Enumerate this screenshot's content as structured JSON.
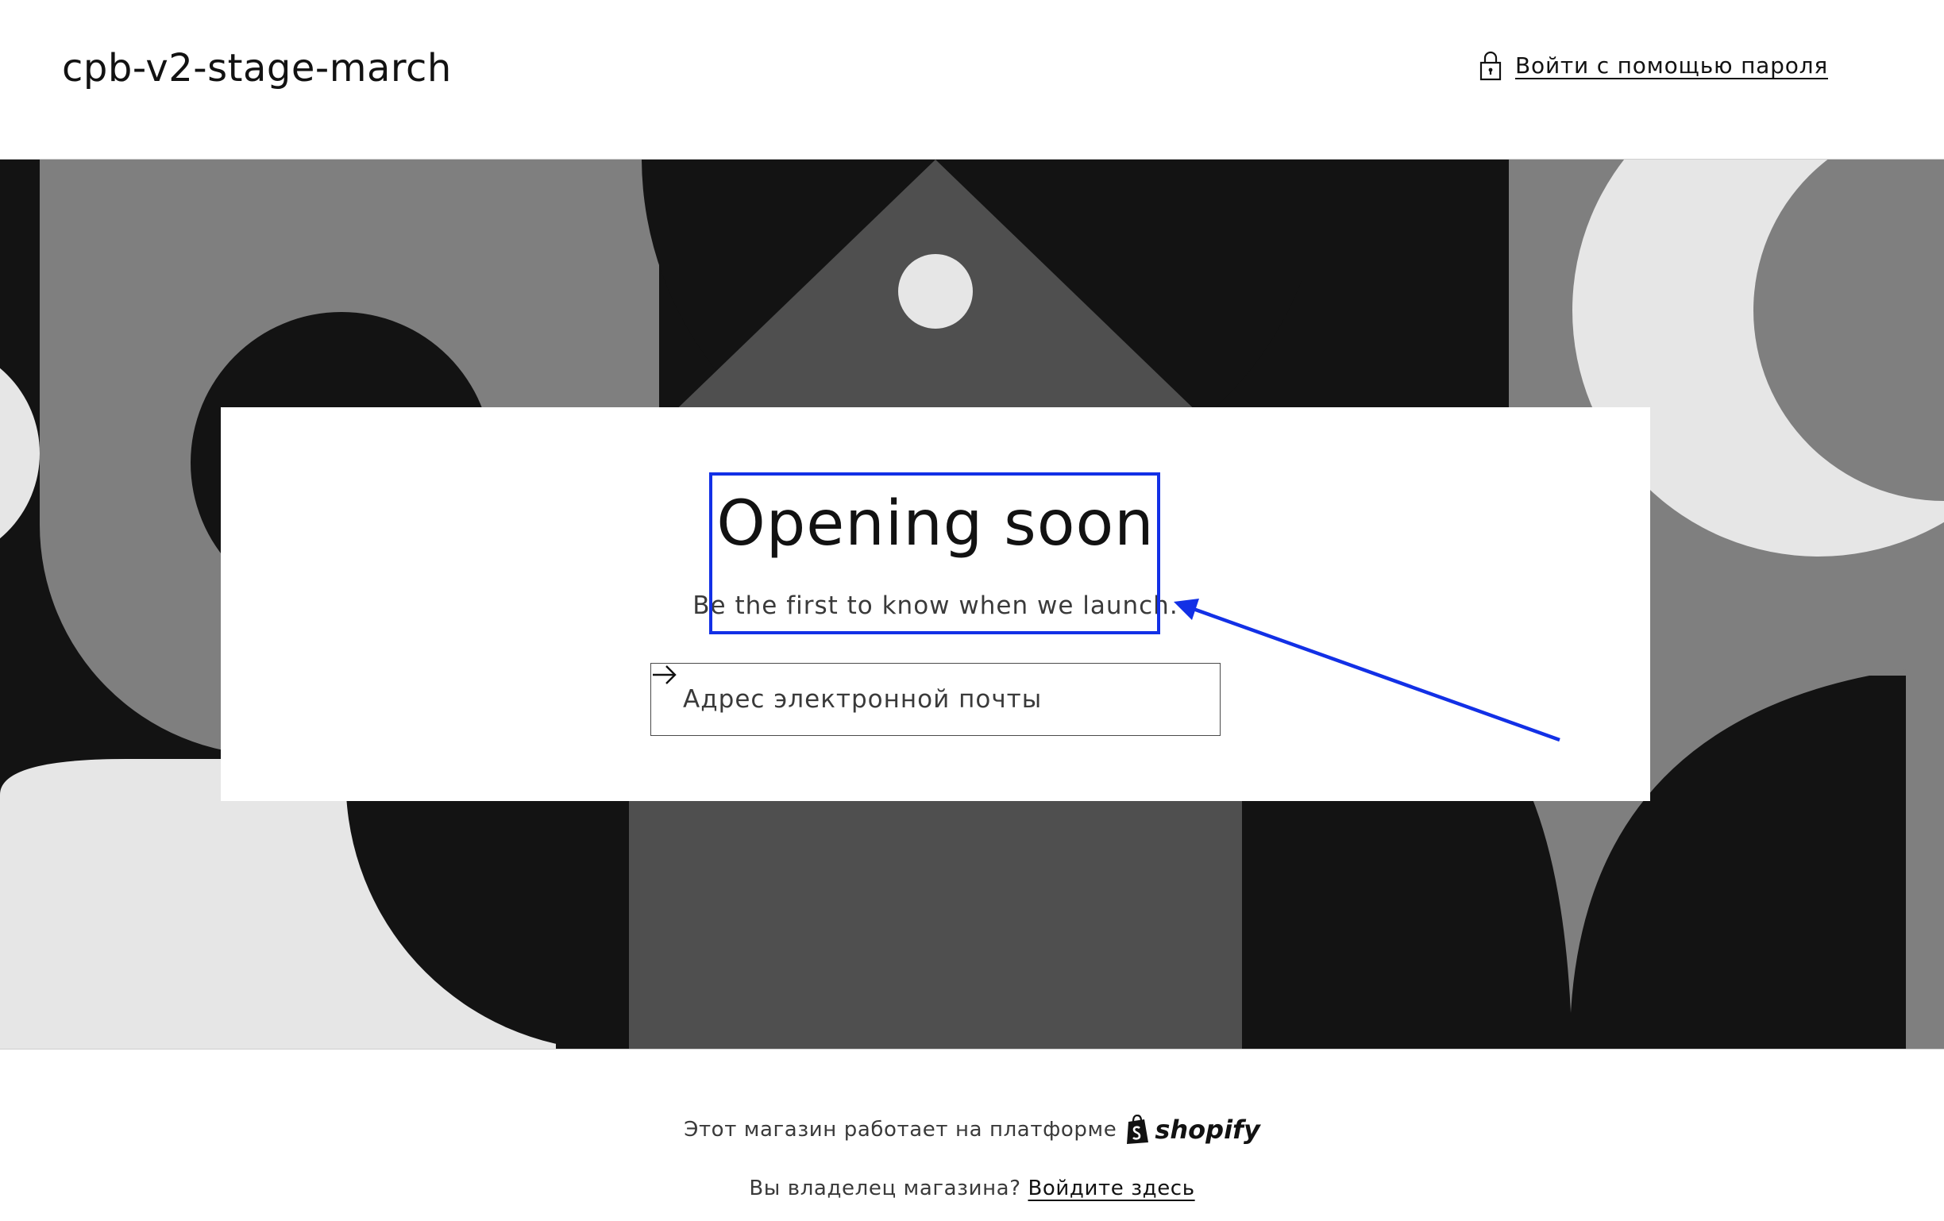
{
  "header": {
    "store_name": "cpb-v2-stage-march",
    "login_label": "Войти с помощью пароля"
  },
  "hero": {
    "headline": "Opening soon",
    "subtext": "Be the first to know when we launch.",
    "email_placeholder": "Адрес электронной почты"
  },
  "footer": {
    "powered_text": "Этот магазин работает на платформе",
    "brand": "shopify",
    "owner_question": "Вы владелец магазина?",
    "owner_link": "Войдите здесь"
  },
  "colors": {
    "annotation": "#1230e6",
    "dark": "#131313",
    "mid_gray": "#7f7f7f",
    "dark_gray": "#4f4f4f",
    "light_gray": "#e6e6e6"
  },
  "icons": {
    "lock": "lock-icon",
    "submit": "arrow-right-icon",
    "brand": "shopify-bag-icon"
  }
}
